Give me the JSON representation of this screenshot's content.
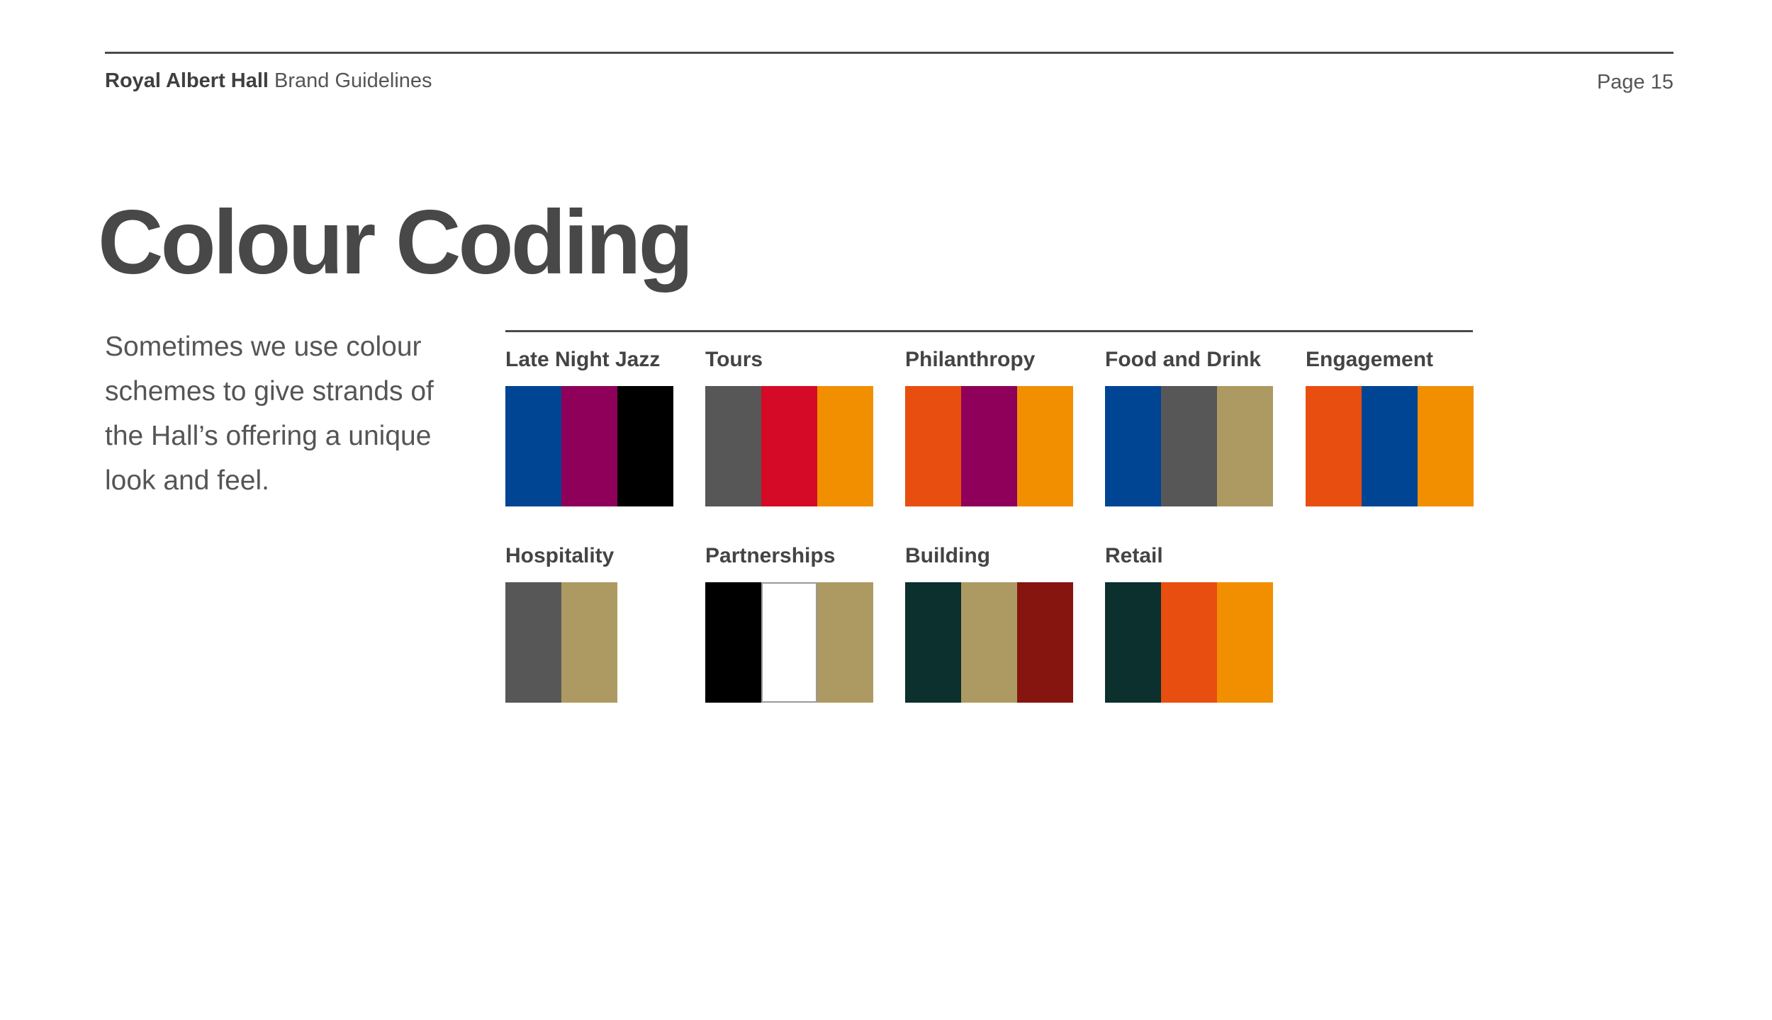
{
  "header": {
    "brand": "Royal Albert Hall",
    "document": "Brand Guidelines",
    "page": "Page 15"
  },
  "title": "Colour Coding",
  "intro": "Sometimes we use colour schemes to give strands of the Hall’s offering a unique look and feel.",
  "schemes": [
    {
      "name": "Late Night Jazz",
      "colors": [
        "#004494",
        "#8e005a",
        "#000000"
      ]
    },
    {
      "name": "Tours",
      "colors": [
        "#575757",
        "#d50a26",
        "#f28f00"
      ]
    },
    {
      "name": "Philanthropy",
      "colors": [
        "#e84e0f",
        "#8e005a",
        "#f28f00"
      ]
    },
    {
      "name": "Food and Drink",
      "colors": [
        "#004494",
        "#575757",
        "#ad9a63"
      ]
    },
    {
      "name": "Engagement",
      "colors": [
        "#e84e0f",
        "#004494",
        "#f28f00"
      ]
    },
    {
      "name": "Hospitality",
      "colors": [
        "#575757",
        "#ad9a63"
      ]
    },
    {
      "name": "Partnerships",
      "colors": [
        "#000000",
        "#ffffff",
        "#ad9a63"
      ]
    },
    {
      "name": "Building",
      "colors": [
        "#0b302e",
        "#ad9a63",
        "#86150f"
      ]
    },
    {
      "name": "Retail",
      "colors": [
        "#0b302e",
        "#e84e0f",
        "#f28f00"
      ]
    }
  ]
}
